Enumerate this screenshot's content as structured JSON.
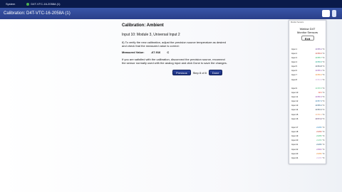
{
  "system": {
    "label": "System",
    "tab": "D4T-VTC-16-2058A (1)"
  },
  "window": {
    "title": "Calibration: D4T-VTC-16-2058A (1)"
  },
  "calibration": {
    "heading": "Calibration: Ambient",
    "input_line": "Input  10: Module 3, Universal Input 2",
    "step_instruction": "8) To verify the new calibration, adjust the precision source temperature as desired and check that the measured value is correct:",
    "measured_label": "Measured Value:",
    "measured_value": "-67.916",
    "measured_unit": "C",
    "done_instruction": "If you are satisfied with the calibration, disconnect the precision source, reconnect the sensor normally used with the analog input and click Done to save the changes."
  },
  "nav": {
    "previous": "Previous",
    "step": "Step 8 of 8",
    "done": "Done"
  },
  "monitor": {
    "header": "Monitor Sensors",
    "title_line1": "Watlow D4T",
    "title_line2": "Monitor Sensors",
    "exit": "Exit",
    "group1": [
      {
        "label": "Input 1",
        "value": "21555.2",
        "unit": "°C",
        "color": "#6a3d9a"
      },
      {
        "label": "Input 2",
        "value": "21556.0",
        "unit": "°C",
        "color": "#c0392b"
      },
      {
        "label": "Input 3",
        "value": "21555.7",
        "unit": "°C",
        "color": "#27ae60"
      },
      {
        "label": "Input 4",
        "value": "21556.6",
        "unit": "°C",
        "color": "#16a085"
      },
      {
        "label": "Input 5",
        "value": "21554.8",
        "unit": "°C",
        "color": "#2c3e50"
      },
      {
        "label": "Input 6",
        "value": "21555.1",
        "unit": "°C",
        "color": "#8e44ad"
      },
      {
        "label": "Input 7",
        "value": "21556.2",
        "unit": "°C",
        "color": "#e67e22"
      },
      {
        "label": "Input 8",
        "value": "21554.9",
        "unit": "°C",
        "color": "#c39bd3"
      }
    ],
    "group2": [
      {
        "label": "Input 9",
        "value": "21555.5",
        "unit": "°C",
        "color": "#52be80"
      },
      {
        "label": "Input 10",
        "value": "-68.0",
        "unit": "°C",
        "color": "#e74c3c"
      },
      {
        "label": "Input 11",
        "value": "21556.3",
        "unit": "°C",
        "color": "#8e44ad"
      },
      {
        "label": "Input 12",
        "value": "21557.3",
        "unit": "°C",
        "color": "#2874a6"
      },
      {
        "label": "Input 13",
        "value": "21555.2",
        "unit": "°C",
        "color": "#1a5276"
      },
      {
        "label": "Input 14",
        "value": "21553.3",
        "unit": "°C",
        "color": "#34495e"
      },
      {
        "label": "Input 15",
        "value": "21556.1",
        "unit": "°C",
        "color": "#e59866"
      },
      {
        "label": "Input 16",
        "value": "21574.2",
        "unit": "°C",
        "color": "#4a235a"
      }
    ],
    "group3": [
      {
        "label": "Input 17",
        "value": "21455.",
        "unit": "°C",
        "color": "#2980b9"
      },
      {
        "label": "Input 18",
        "value": "21459.",
        "unit": "°C",
        "color": "#c0392b"
      },
      {
        "label": "Input 19",
        "value": "21455.",
        "unit": "°C",
        "color": "#27ae60"
      },
      {
        "label": "Input 20",
        "value": "21455.",
        "unit": "°C",
        "color": "#52be80"
      },
      {
        "label": "Input 21",
        "value": "21455.",
        "unit": "°C",
        "color": "#1a5276"
      },
      {
        "label": "Input 22",
        "value": "21560.",
        "unit": "°C",
        "color": "#8e44ad"
      },
      {
        "label": "Input 23",
        "value": "21456.",
        "unit": "°C",
        "color": "#e67e22"
      },
      {
        "label": "Input 24",
        "value": "21455.",
        "unit": "°C",
        "color": "#c39bd3"
      }
    ]
  }
}
